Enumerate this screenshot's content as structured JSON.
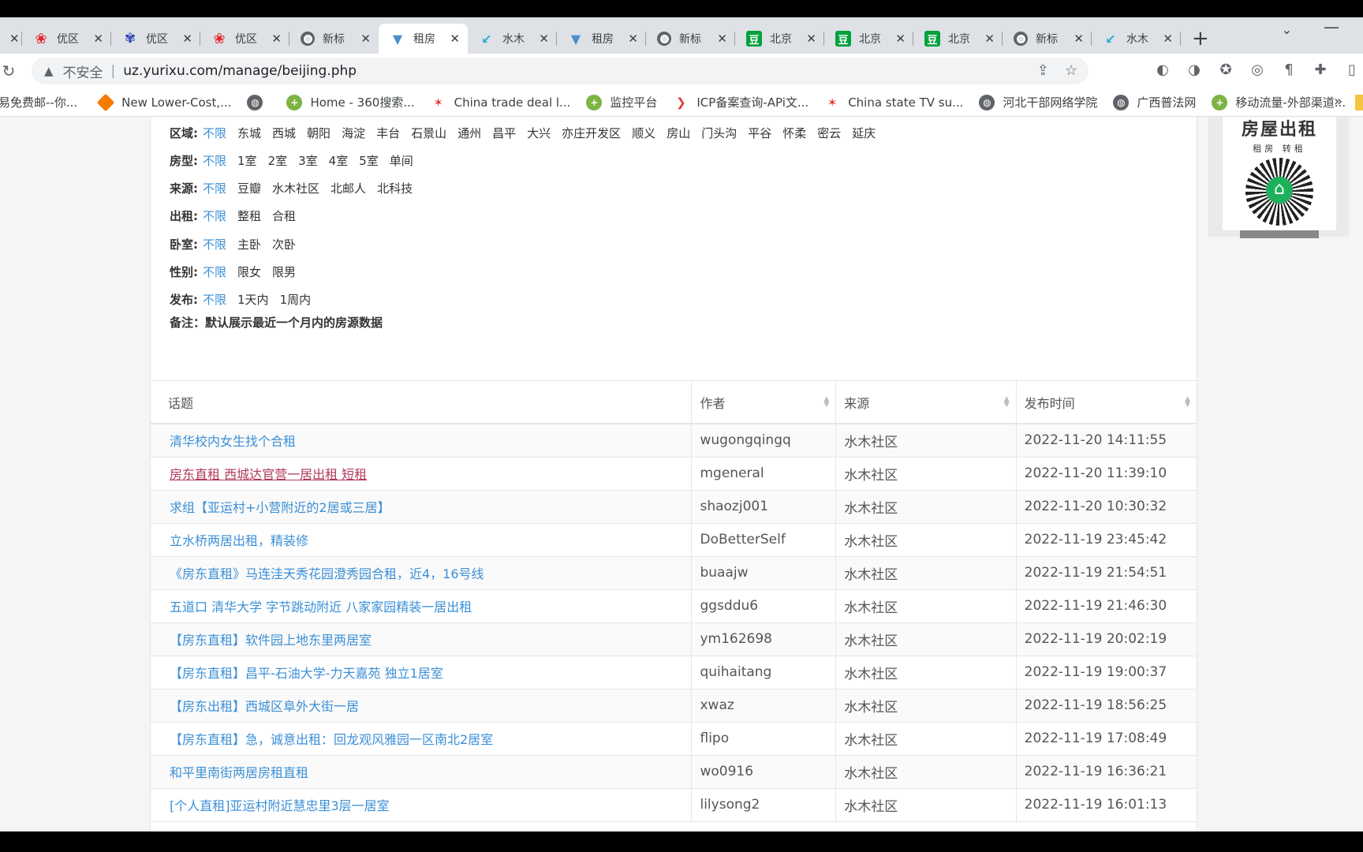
{
  "browser": {
    "tabs": [
      {
        "title": "",
        "icon": "close"
      },
      {
        "title": "优区",
        "icon": "huawei"
      },
      {
        "title": "优区",
        "icon": "baidu"
      },
      {
        "title": "优区",
        "icon": "huawei"
      },
      {
        "title": "新标",
        "icon": "chrome"
      },
      {
        "title": "租房",
        "icon": "zufang",
        "active": true
      },
      {
        "title": "水木",
        "icon": "shuimu"
      },
      {
        "title": "租房",
        "icon": "zufang"
      },
      {
        "title": "新标",
        "icon": "chrome"
      },
      {
        "title": "北京",
        "icon": "douban"
      },
      {
        "title": "北京",
        "icon": "douban"
      },
      {
        "title": "北京",
        "icon": "douban"
      },
      {
        "title": "新标",
        "icon": "chrome"
      },
      {
        "title": "水木",
        "icon": "shuimu"
      }
    ],
    "new_tab": "+",
    "security_label": "不安全",
    "url": "uz.yurixu.com/manage/beijing.php",
    "bookmarks": [
      {
        "label": "易免费邮--你...",
        "icon": "none"
      },
      {
        "label": "New Lower-Cost,...",
        "icon": "orange"
      },
      {
        "label": "",
        "icon": "globe"
      },
      {
        "label": "Home - 360搜索...",
        "icon": "360"
      },
      {
        "label": "China trade deal l...",
        "icon": "nbc"
      },
      {
        "label": "监控平台",
        "icon": "360"
      },
      {
        "label": "ICP备案查询-APi文...",
        "icon": "icp"
      },
      {
        "label": "China state TV su...",
        "icon": "nbc"
      },
      {
        "label": "河北干部网络学院",
        "icon": "globe"
      },
      {
        "label": "广西普法网",
        "icon": "globe"
      },
      {
        "label": "移动流量-外部渠道...",
        "icon": "360"
      }
    ],
    "bookmarks_more": "»"
  },
  "filters": [
    {
      "label": "区域:",
      "options": [
        "不限",
        "东城",
        "西城",
        "朝阳",
        "海淀",
        "丰台",
        "石景山",
        "通州",
        "昌平",
        "大兴",
        "亦庄开发区",
        "顺义",
        "房山",
        "门头沟",
        "平谷",
        "怀柔",
        "密云",
        "延庆"
      ]
    },
    {
      "label": "房型:",
      "options": [
        "不限",
        "1室",
        "2室",
        "3室",
        "4室",
        "5室",
        "单间"
      ]
    },
    {
      "label": "来源:",
      "options": [
        "不限",
        "豆瓣",
        "水木社区",
        "北邮人",
        "北科技"
      ]
    },
    {
      "label": "出租:",
      "options": [
        "不限",
        "整租",
        "合租"
      ]
    },
    {
      "label": "卧室:",
      "options": [
        "不限",
        "主卧",
        "次卧"
      ]
    },
    {
      "label": "性别:",
      "options": [
        "不限",
        "限女",
        "限男"
      ]
    },
    {
      "label": "发布:",
      "options": [
        "不限",
        "1天内",
        "1周内"
      ]
    }
  ],
  "note": "备注：默认展示最近一个月内的房源数据",
  "ad": {
    "title": "房屋出租",
    "subtitle": "租房 转租"
  },
  "table": {
    "headers": [
      "话题",
      "作者",
      "来源",
      "发布时间"
    ],
    "rows": [
      {
        "topic": "清华校内女生找个合租",
        "author": "wugongqingq",
        "source": "水木社区",
        "time": "2022-11-20 14:11:55"
      },
      {
        "topic": "房东直租 西城达官营一居出租 短租",
        "author": "mgeneral",
        "source": "水木社区",
        "time": "2022-11-20 11:39:10",
        "visited": true
      },
      {
        "topic": "求组【亚运村+小营附近的2居或三居】",
        "author": "shaozj001",
        "source": "水木社区",
        "time": "2022-11-20 10:30:32"
      },
      {
        "topic": "立水桥两居出租，精装修",
        "author": "DoBetterSelf",
        "source": "水木社区",
        "time": "2022-11-19 23:45:42"
      },
      {
        "topic": "《房东直租》马连洼天秀花园澄秀园合租，近4，16号线",
        "author": "buaajw",
        "source": "水木社区",
        "time": "2022-11-19 21:54:51"
      },
      {
        "topic": "五道口 清华大学 字节跳动附近 八家家园精装一居出租",
        "author": "ggsddu6",
        "source": "水木社区",
        "time": "2022-11-19 21:46:30"
      },
      {
        "topic": "【房东直租】软件园上地东里两居室",
        "author": "ym162698",
        "source": "水木社区",
        "time": "2022-11-19 20:02:19"
      },
      {
        "topic": "【房东直租】昌平-石油大学-力天嘉苑 独立1居室",
        "author": "quihaitang",
        "source": "水木社区",
        "time": "2022-11-19 19:00:37"
      },
      {
        "topic": "【房东出租】西城区阜外大街一居",
        "author": "xwaz",
        "source": "水木社区",
        "time": "2022-11-19 18:56:25"
      },
      {
        "topic": "【房东直租】急，诚意出租：回龙观风雅园一区南北2居室",
        "author": "flipo",
        "source": "水木社区",
        "time": "2022-11-19 17:08:49"
      },
      {
        "topic": "和平里南街两居房租直租",
        "author": "wo0916",
        "source": "水木社区",
        "time": "2022-11-19 16:36:21"
      },
      {
        "topic": "[个人直租]亚运村附近慧忠里3层一居室",
        "author": "lilysong2",
        "source": "水木社区",
        "time": "2022-11-19 16:01:13"
      }
    ]
  }
}
